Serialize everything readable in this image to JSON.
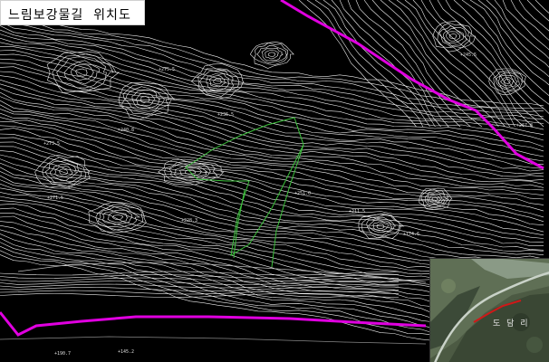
{
  "title": "느림보강물길  위치도",
  "inset": {
    "label": "도 담 리"
  },
  "map_labels": {
    "elev_top_right": "+245.5",
    "elev_right": "+267.8",
    "elev_left_1": "+273.5",
    "elev_left_2": "+271.5",
    "elev_center": "+251.0",
    "elev_bottom_left": "+190.7",
    "elev_bottom_mid": "+145.2",
    "elev_a": "+275.5",
    "elev_b": "+236.5",
    "elev_c": "+240.8",
    "elev_d": "+228.3",
    "elev_e": "+211.5",
    "elev_f": "+174.6"
  },
  "colors": {
    "background": "#000000",
    "contour": "#f0f0f0",
    "road": "#e000e0",
    "trail_green": "#3cc23c",
    "inset_path": "#d01818"
  }
}
